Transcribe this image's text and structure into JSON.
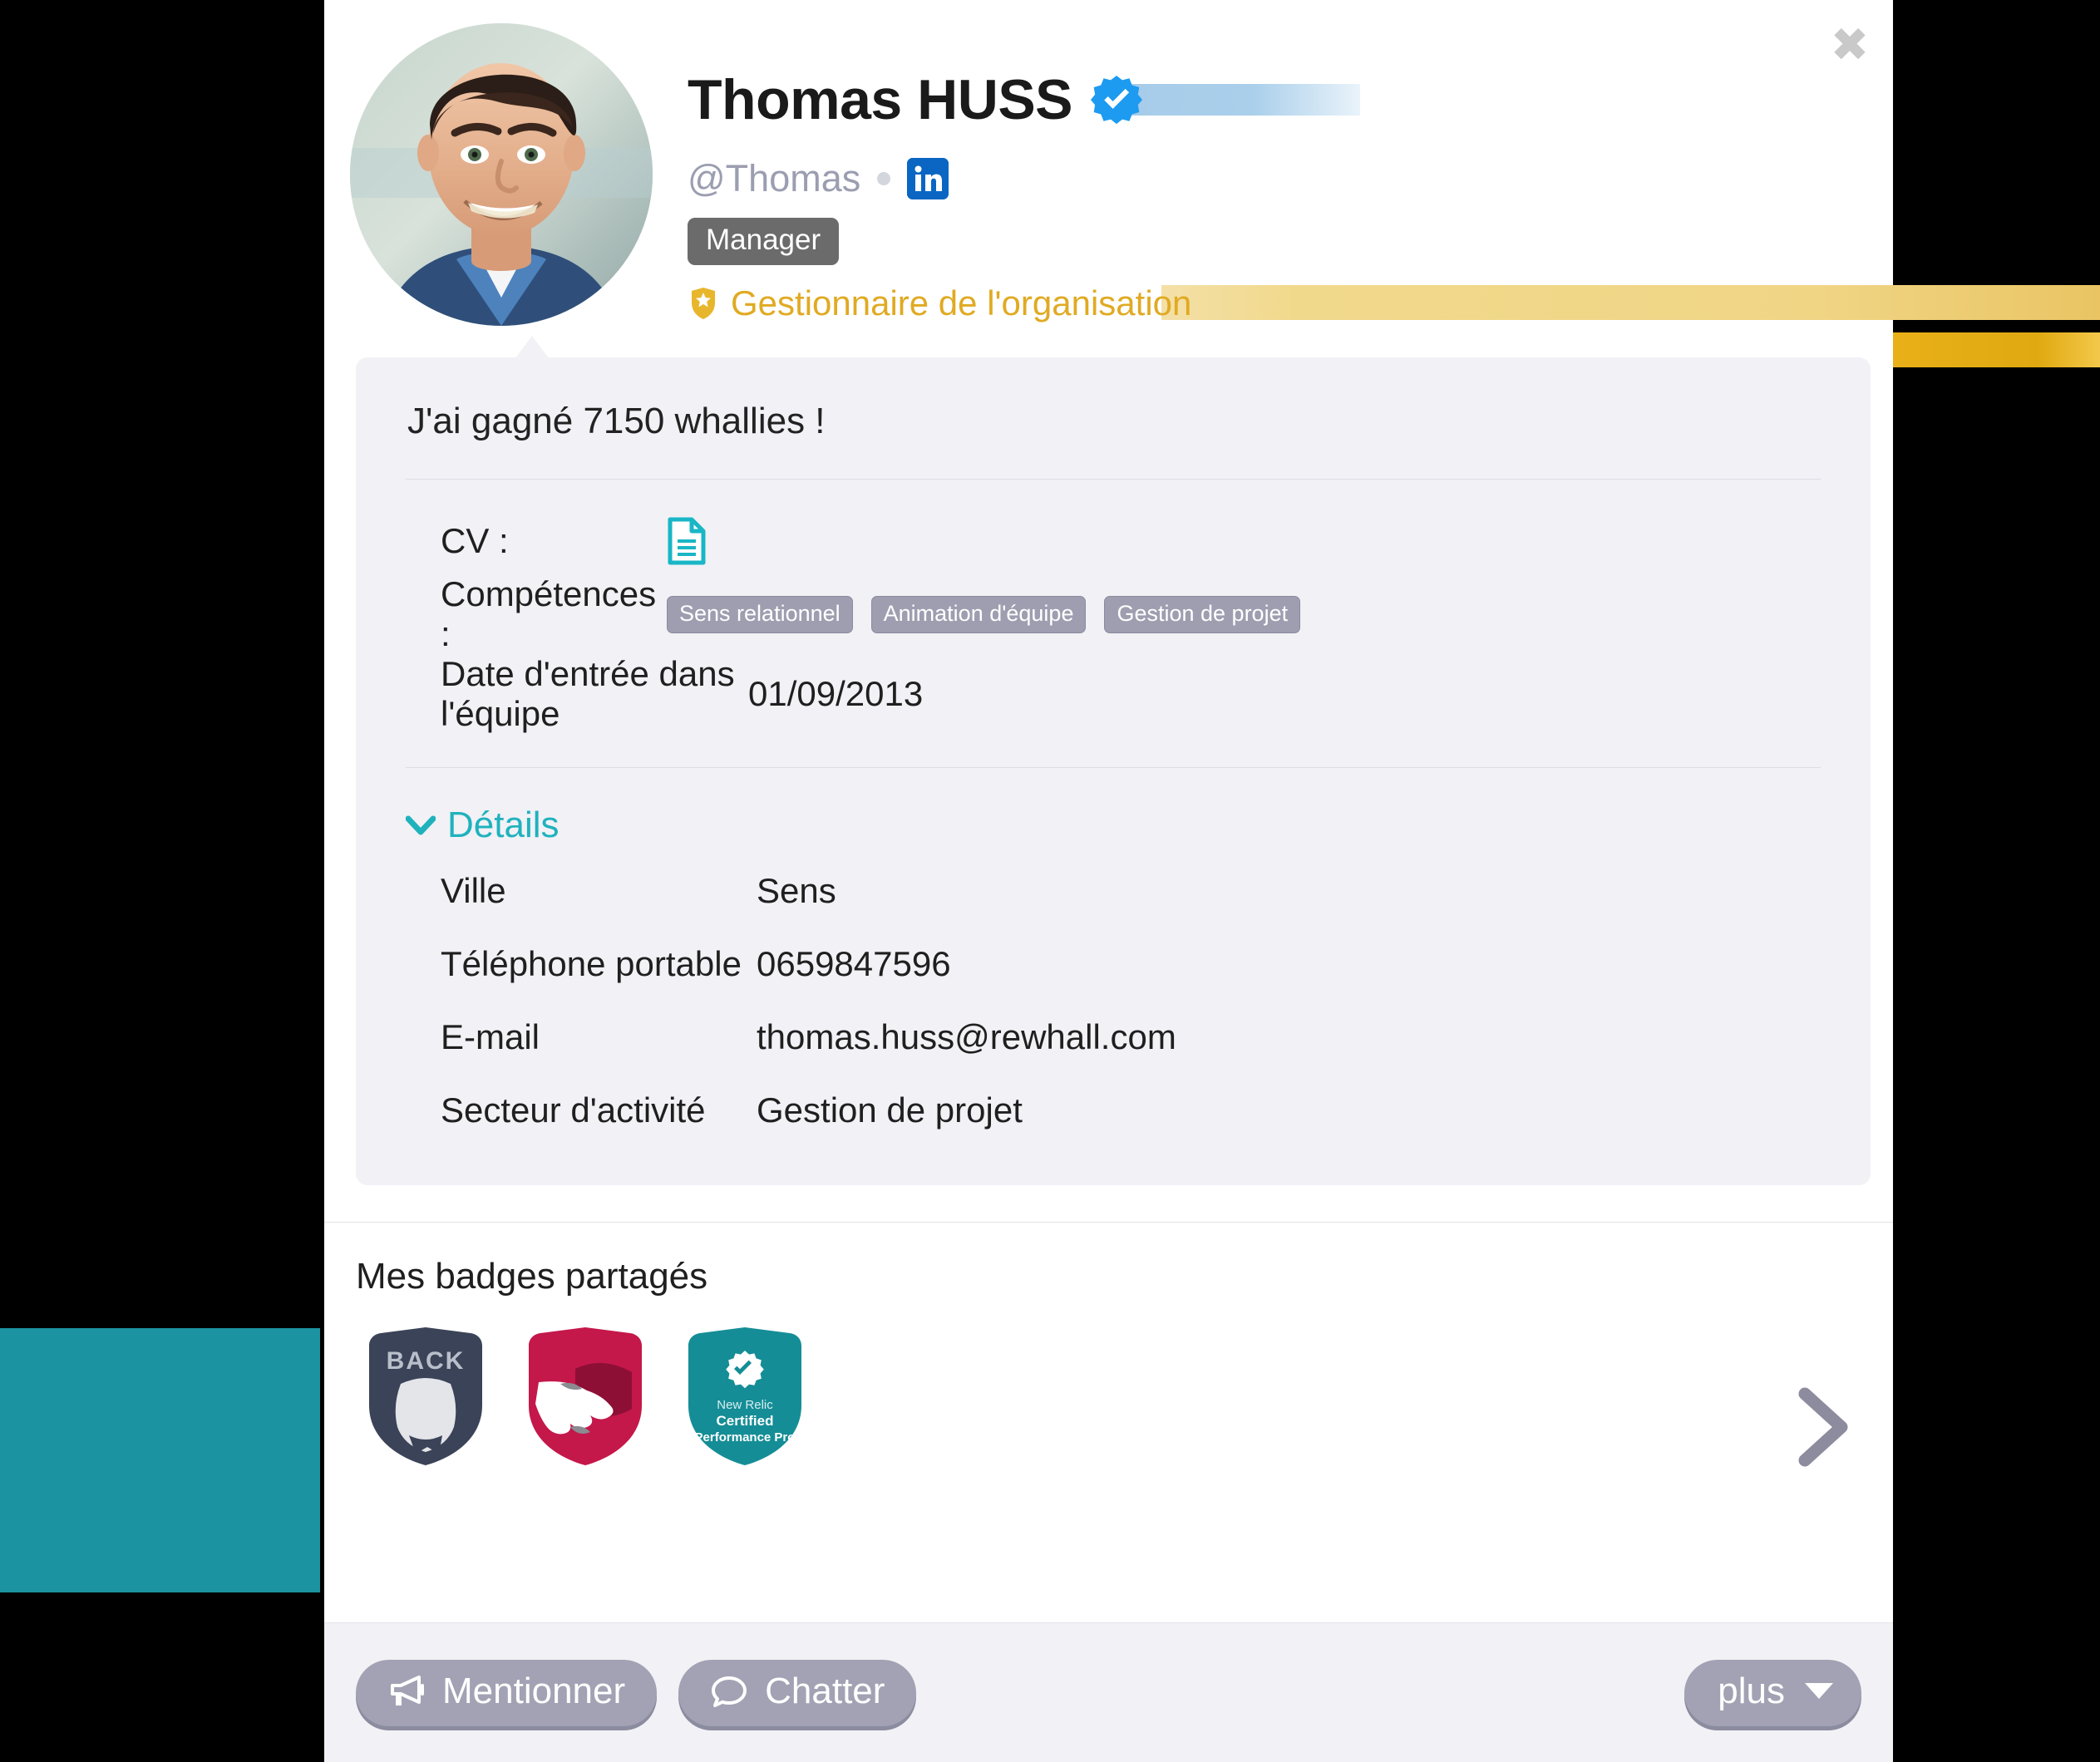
{
  "profile": {
    "name": "Thomas HUSS",
    "handle": "@Thomas",
    "role_chip": "Manager",
    "org_role": "Gestionnaire de l'organisation",
    "verified_icon": "verified-badge-icon",
    "linkedin_icon": "linkedin-icon",
    "avatar_alt": "profile-photo"
  },
  "card": {
    "status_line": "J'ai gagné 7150 whallies !",
    "cv_label": "CV :",
    "cv_icon": "document-icon",
    "skills_label": "Compétences :",
    "skills": [
      "Sens relationnel",
      "Animation d'équipe",
      "Gestion de projet"
    ],
    "join_date_label": "Date d'entrée dans l'équipe",
    "join_date_value": "01/09/2013",
    "details_label": "Détails",
    "details": [
      {
        "key": "Ville",
        "value": "Sens"
      },
      {
        "key": "Téléphone portable",
        "value": "0659847596"
      },
      {
        "key": "E-mail",
        "value": "thomas.huss@rewhall.com"
      },
      {
        "key": "Secteur d'activité",
        "value": "Gestion de projet"
      }
    ]
  },
  "badges": {
    "title": "Mes badges partagés",
    "items": [
      {
        "name": "back-badge",
        "label": "BACK"
      },
      {
        "name": "handshake-badge",
        "label": ""
      },
      {
        "name": "new-relic-certified-performance-pro-badge",
        "line1": "New Relic",
        "line2": "Certified",
        "line3": "Performance Pro"
      }
    ],
    "next_icon": "chevron-right-icon"
  },
  "footer": {
    "mention_label": "Mentionner",
    "mention_icon": "megaphone-icon",
    "chat_label": "Chatter",
    "chat_icon": "speech-bubble-icon",
    "more_label": "plus",
    "more_icon": "caret-down-icon"
  },
  "window": {
    "close_icon": "close-icon",
    "close_glyph": "✖"
  },
  "colors": {
    "accent_teal": "#1fb2bd",
    "gold": "#e0aa22",
    "verified_blue": "#1d9bf0",
    "linkedin_blue": "#0a66c2",
    "chip_gray": "#6b6b6b",
    "tag_gray": "#9e9eb0",
    "button_gray": "#a2a2b4",
    "card_bg": "#f1f1f6",
    "bg_teal_block": "#1b93a0"
  }
}
